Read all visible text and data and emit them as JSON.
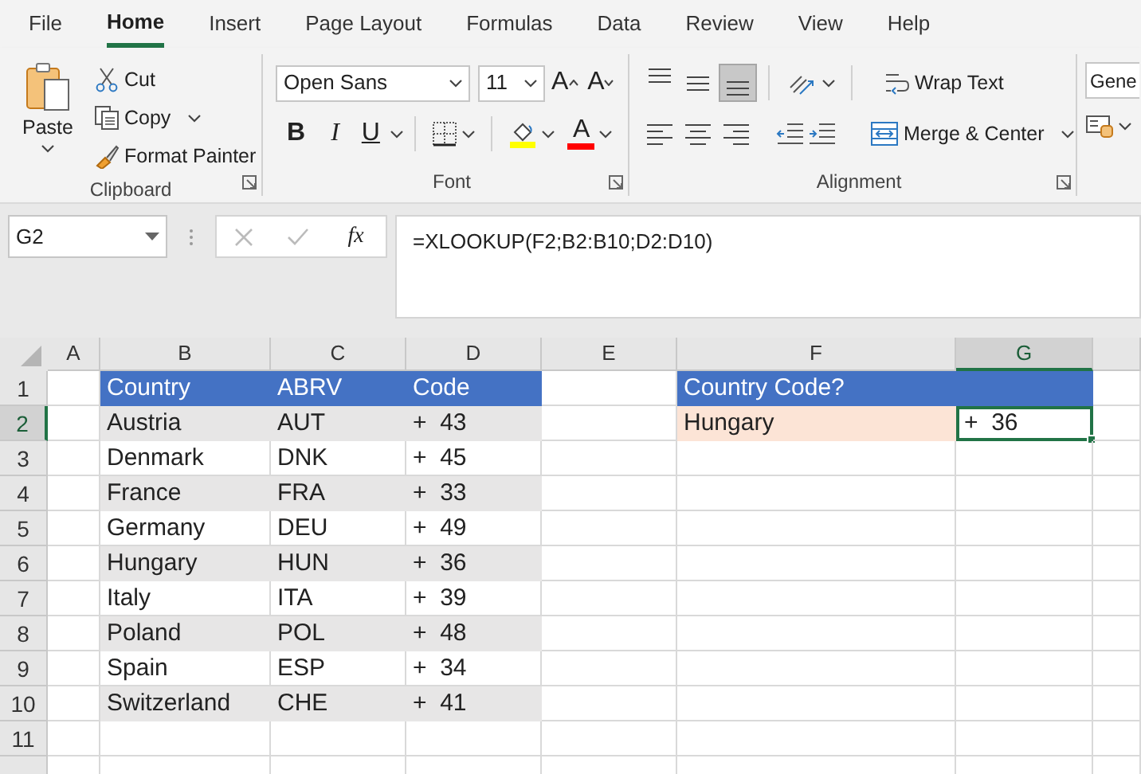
{
  "ribbon_tabs": [
    {
      "label": "File",
      "selected": false
    },
    {
      "label": "Home",
      "selected": true
    },
    {
      "label": "Insert",
      "selected": false
    },
    {
      "label": "Page Layout",
      "selected": false
    },
    {
      "label": "Formulas",
      "selected": false
    },
    {
      "label": "Data",
      "selected": false
    },
    {
      "label": "Review",
      "selected": false
    },
    {
      "label": "View",
      "selected": false
    },
    {
      "label": "Help",
      "selected": false
    }
  ],
  "clipboard": {
    "paste": "Paste",
    "cut": "Cut",
    "copy": "Copy",
    "format_painter": "Format Painter",
    "label": "Clipboard"
  },
  "font": {
    "font_name": "Open Sans",
    "font_size": "11",
    "grow_font": "A",
    "shrink_font": "A",
    "bold": "B",
    "italic": "I",
    "underline": "U",
    "font_color": "A",
    "label": "Font"
  },
  "alignment": {
    "vertical": [
      {
        "selected": false
      },
      {
        "selected": false
      },
      {
        "selected": true
      }
    ],
    "wrap_text": "Wrap Text",
    "merge_center": "Merge & Center",
    "label": "Alignment"
  },
  "number": {
    "format": "Gene"
  },
  "formula_bar": {
    "name_box": "G2",
    "function_label": "fx",
    "formula": "=XLOOKUP(F2;B2:B10;D2:D10)"
  },
  "sheet": {
    "columns": [
      {
        "label": "A",
        "selected": false
      },
      {
        "label": "B",
        "selected": false
      },
      {
        "label": "C",
        "selected": false
      },
      {
        "label": "D",
        "selected": false
      },
      {
        "label": "E",
        "selected": false
      },
      {
        "label": "F",
        "selected": false
      },
      {
        "label": "G",
        "selected": true
      }
    ],
    "rows": [
      {
        "label": "1",
        "selected": false,
        "cells": [
          {},
          {
            "text": "Country",
            "kind": "header"
          },
          {
            "text": "ABRV",
            "kind": "header"
          },
          {
            "text": "Code",
            "kind": "header"
          },
          {},
          {
            "text": "Country Code?",
            "kind": "header"
          },
          {
            "kind": "header"
          }
        ]
      },
      {
        "label": "2",
        "selected": true,
        "cells": [
          {},
          {
            "text": "Austria",
            "kind": "band"
          },
          {
            "text": "AUT",
            "kind": "band"
          },
          {
            "text": "+  43",
            "kind": "band"
          },
          {},
          {
            "text": "Hungary",
            "kind": "input"
          },
          {
            "text": "+  36"
          }
        ]
      },
      {
        "label": "3",
        "selected": false,
        "cells": [
          {},
          {
            "text": "Denmark"
          },
          {
            "text": "DNK"
          },
          {
            "text": "+  45"
          }
        ]
      },
      {
        "label": "4",
        "selected": false,
        "cells": [
          {},
          {
            "text": "France",
            "kind": "band"
          },
          {
            "text": "FRA",
            "kind": "band"
          },
          {
            "text": "+  33",
            "kind": "band"
          }
        ]
      },
      {
        "label": "5",
        "selected": false,
        "cells": [
          {},
          {
            "text": "Germany"
          },
          {
            "text": "DEU"
          },
          {
            "text": "+  49"
          }
        ]
      },
      {
        "label": "6",
        "selected": false,
        "cells": [
          {},
          {
            "text": "Hungary",
            "kind": "band"
          },
          {
            "text": "HUN",
            "kind": "band"
          },
          {
            "text": "+  36",
            "kind": "band"
          }
        ]
      },
      {
        "label": "7",
        "selected": false,
        "cells": [
          {},
          {
            "text": "Italy"
          },
          {
            "text": "ITA"
          },
          {
            "text": "+  39"
          }
        ]
      },
      {
        "label": "8",
        "selected": false,
        "cells": [
          {},
          {
            "text": "Poland",
            "kind": "band"
          },
          {
            "text": "POL",
            "kind": "band"
          },
          {
            "text": "+  48",
            "kind": "band"
          }
        ]
      },
      {
        "label": "9",
        "selected": false,
        "cells": [
          {},
          {
            "text": "Spain"
          },
          {
            "text": "ESP"
          },
          {
            "text": "+  34"
          }
        ]
      },
      {
        "label": "10",
        "selected": false,
        "cells": [
          {},
          {
            "text": "Switzerland",
            "kind": "band"
          },
          {
            "text": "CHE",
            "kind": "band"
          },
          {
            "text": "+  41",
            "kind": "band"
          }
        ]
      },
      {
        "label": "11",
        "selected": false
      }
    ]
  }
}
